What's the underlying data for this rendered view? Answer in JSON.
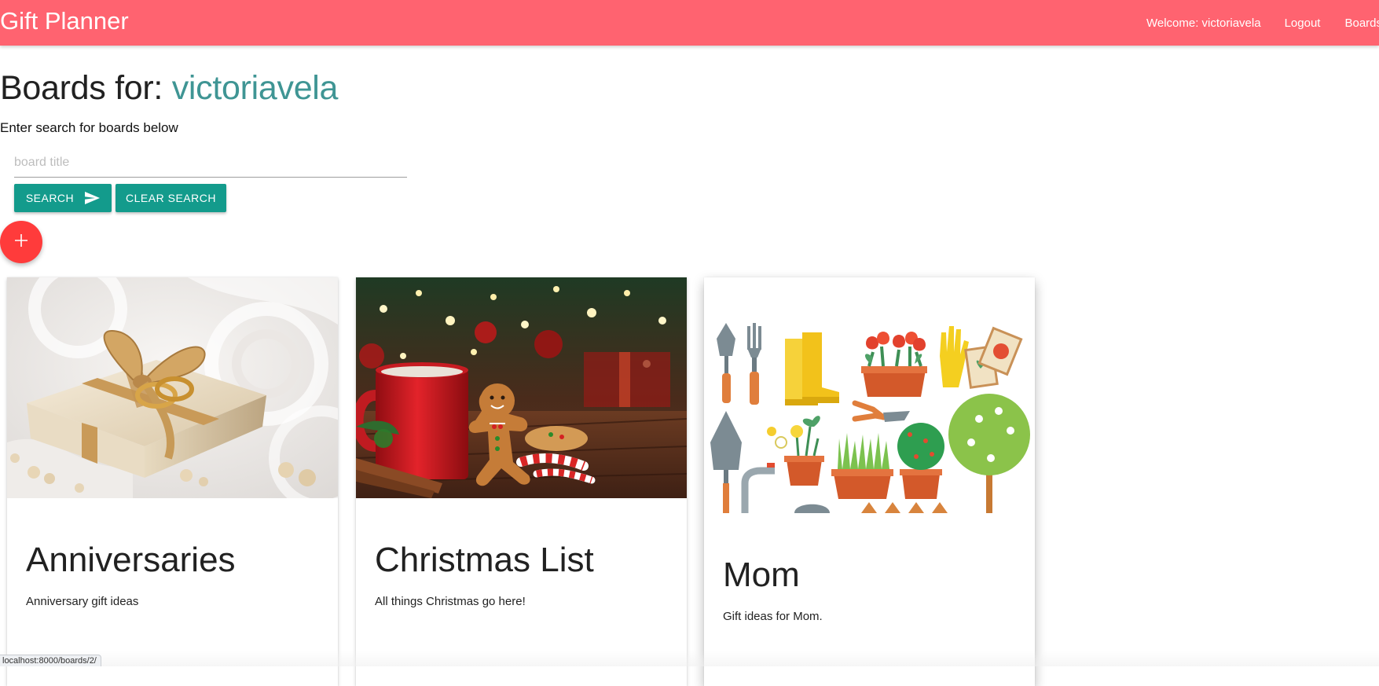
{
  "navbar": {
    "brand": "Gift Planner",
    "welcome": "Welcome: victoriavela",
    "logout": "Logout",
    "boards": "Boards",
    "color": "#ff6370"
  },
  "header": {
    "title_prefix": "Boards for:",
    "username": "victoriavela",
    "username_color": "#3f9594"
  },
  "search": {
    "instructions": "Enter search for boards below",
    "placeholder": "board title",
    "value": "",
    "search_label": "SEARCH",
    "clear_label": "CLEAR SEARCH",
    "button_color": "#139b8c"
  },
  "add_button": {
    "icon": "plus-icon",
    "color": "#ff3b3b"
  },
  "boards": [
    {
      "title": "Anniversaries",
      "description": "Anniversary gift ideas",
      "image": "wedding-rings-gift-box"
    },
    {
      "title": "Christmas List",
      "description": "All things Christmas go here!",
      "image": "mug-gingerbread-christmas"
    },
    {
      "title": "Mom",
      "description": "Gift ideas for Mom.",
      "image": "gardening-tools-plants"
    }
  ],
  "status_bar": {
    "url": "localhost:8000/boards/2/"
  }
}
